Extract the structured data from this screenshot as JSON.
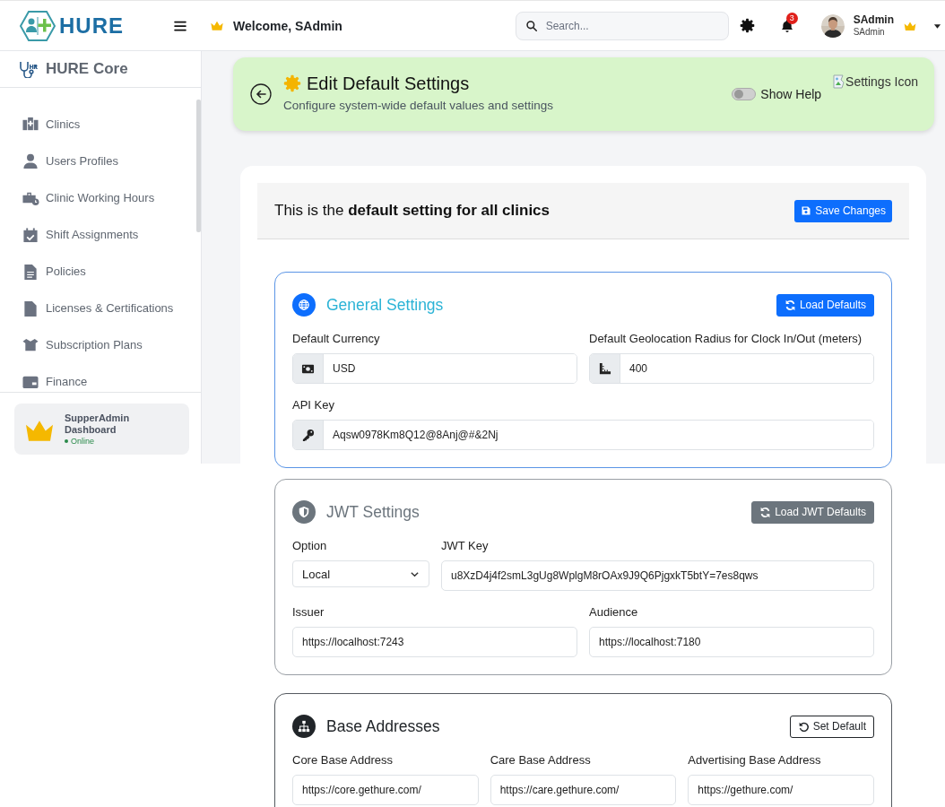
{
  "header": {
    "logo_text": "HURE",
    "welcome": "Welcome, SAdmin",
    "search": {
      "placeholder": "Search..."
    },
    "notification_count": "3",
    "user": {
      "name": "SAdmin",
      "role": "SAdmin"
    }
  },
  "sidebar": {
    "title": "HURE Core",
    "items": [
      {
        "label": "Clinics"
      },
      {
        "label": "Users Profiles"
      },
      {
        "label": "Clinic Working Hours"
      },
      {
        "label": "Shift Assignments"
      },
      {
        "label": "Policies"
      },
      {
        "label": "Licenses & Certifications"
      },
      {
        "label": "Subscription Plans"
      },
      {
        "label": "Finance"
      }
    ],
    "footer": {
      "title": "SupperAdmin Dashboard",
      "status": "Online"
    }
  },
  "banner": {
    "title": "Edit Default Settings",
    "subtitle": "Configure system-wide default values and settings",
    "help_toggle": {
      "label": "Show Help",
      "on": false
    },
    "image_alt": "Settings Icon"
  },
  "content": {
    "heading": "This is the **default setting for all clinics**",
    "save_button": "Save Changes",
    "sections": [
      {
        "kind": "primary",
        "title": "General Settings",
        "button": "Load Defaults",
        "rows": [
          [
            {
              "kind": "addon",
              "label": "Default Currency",
              "value": "USD"
            },
            {
              "kind": "addon",
              "label": "Default Geolocation Radius for Clock In/Out (meters)",
              "value": "400"
            }
          ],
          [
            {
              "kind": "addon",
              "label": "API Key",
              "value": "Aqsw0978Km8Q12@8Anj@#&2Nj"
            }
          ]
        ]
      },
      {
        "kind": "secondary",
        "title": "JWT Settings",
        "button": "Load JWT Defaults",
        "rows": [
          [
            {
              "kind": "select",
              "label": "Option",
              "value": "Local"
            },
            {
              "kind": "text",
              "label": "JWT Key",
              "value": "u8XzD4j4f2smL3gUg8WplgM8rOAx9J9Q6PjgxkT5btY=7es8qws"
            }
          ],
          [
            {
              "kind": "text",
              "label": "Issuer",
              "value": "https://localhost:7243"
            },
            {
              "kind": "text",
              "label": "Audience",
              "value": "https://localhost:7180"
            }
          ]
        ]
      },
      {
        "kind": "dark",
        "title": "Base Addresses",
        "button": "Set Default",
        "rows": [
          [
            {
              "kind": "text",
              "label": "Core Base Address",
              "value": "https://core.gethure.com/"
            },
            {
              "kind": "text",
              "label": "Care Base Address",
              "value": "https://care.gethure.com/"
            },
            {
              "kind": "text",
              "label": "Advertising Base Address",
              "value": "https://gethure.com/"
            }
          ]
        ]
      }
    ]
  }
}
